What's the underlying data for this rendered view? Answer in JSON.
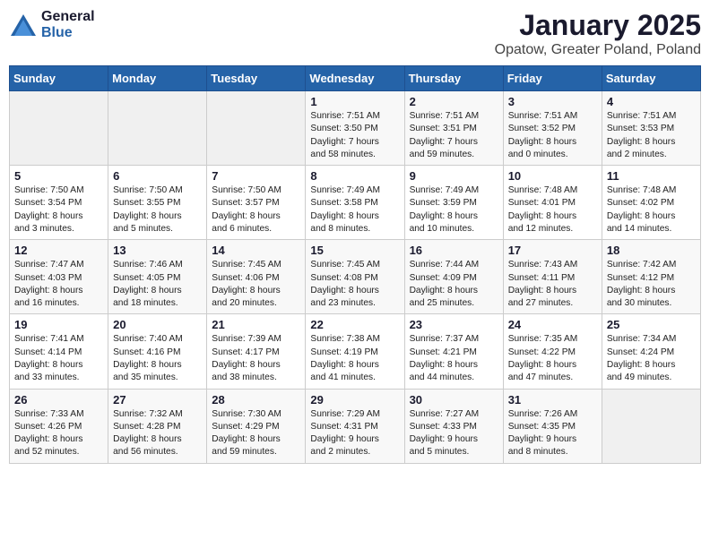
{
  "logo": {
    "general": "General",
    "blue": "Blue"
  },
  "title": "January 2025",
  "subtitle": "Opatow, Greater Poland, Poland",
  "weekdays": [
    "Sunday",
    "Monday",
    "Tuesday",
    "Wednesday",
    "Thursday",
    "Friday",
    "Saturday"
  ],
  "weeks": [
    [
      {
        "day": "",
        "content": ""
      },
      {
        "day": "",
        "content": ""
      },
      {
        "day": "",
        "content": ""
      },
      {
        "day": "1",
        "content": "Sunrise: 7:51 AM\nSunset: 3:50 PM\nDaylight: 7 hours\nand 58 minutes."
      },
      {
        "day": "2",
        "content": "Sunrise: 7:51 AM\nSunset: 3:51 PM\nDaylight: 7 hours\nand 59 minutes."
      },
      {
        "day": "3",
        "content": "Sunrise: 7:51 AM\nSunset: 3:52 PM\nDaylight: 8 hours\nand 0 minutes."
      },
      {
        "day": "4",
        "content": "Sunrise: 7:51 AM\nSunset: 3:53 PM\nDaylight: 8 hours\nand 2 minutes."
      }
    ],
    [
      {
        "day": "5",
        "content": "Sunrise: 7:50 AM\nSunset: 3:54 PM\nDaylight: 8 hours\nand 3 minutes."
      },
      {
        "day": "6",
        "content": "Sunrise: 7:50 AM\nSunset: 3:55 PM\nDaylight: 8 hours\nand 5 minutes."
      },
      {
        "day": "7",
        "content": "Sunrise: 7:50 AM\nSunset: 3:57 PM\nDaylight: 8 hours\nand 6 minutes."
      },
      {
        "day": "8",
        "content": "Sunrise: 7:49 AM\nSunset: 3:58 PM\nDaylight: 8 hours\nand 8 minutes."
      },
      {
        "day": "9",
        "content": "Sunrise: 7:49 AM\nSunset: 3:59 PM\nDaylight: 8 hours\nand 10 minutes."
      },
      {
        "day": "10",
        "content": "Sunrise: 7:48 AM\nSunset: 4:01 PM\nDaylight: 8 hours\nand 12 minutes."
      },
      {
        "day": "11",
        "content": "Sunrise: 7:48 AM\nSunset: 4:02 PM\nDaylight: 8 hours\nand 14 minutes."
      }
    ],
    [
      {
        "day": "12",
        "content": "Sunrise: 7:47 AM\nSunset: 4:03 PM\nDaylight: 8 hours\nand 16 minutes."
      },
      {
        "day": "13",
        "content": "Sunrise: 7:46 AM\nSunset: 4:05 PM\nDaylight: 8 hours\nand 18 minutes."
      },
      {
        "day": "14",
        "content": "Sunrise: 7:45 AM\nSunset: 4:06 PM\nDaylight: 8 hours\nand 20 minutes."
      },
      {
        "day": "15",
        "content": "Sunrise: 7:45 AM\nSunset: 4:08 PM\nDaylight: 8 hours\nand 23 minutes."
      },
      {
        "day": "16",
        "content": "Sunrise: 7:44 AM\nSunset: 4:09 PM\nDaylight: 8 hours\nand 25 minutes."
      },
      {
        "day": "17",
        "content": "Sunrise: 7:43 AM\nSunset: 4:11 PM\nDaylight: 8 hours\nand 27 minutes."
      },
      {
        "day": "18",
        "content": "Sunrise: 7:42 AM\nSunset: 4:12 PM\nDaylight: 8 hours\nand 30 minutes."
      }
    ],
    [
      {
        "day": "19",
        "content": "Sunrise: 7:41 AM\nSunset: 4:14 PM\nDaylight: 8 hours\nand 33 minutes."
      },
      {
        "day": "20",
        "content": "Sunrise: 7:40 AM\nSunset: 4:16 PM\nDaylight: 8 hours\nand 35 minutes."
      },
      {
        "day": "21",
        "content": "Sunrise: 7:39 AM\nSunset: 4:17 PM\nDaylight: 8 hours\nand 38 minutes."
      },
      {
        "day": "22",
        "content": "Sunrise: 7:38 AM\nSunset: 4:19 PM\nDaylight: 8 hours\nand 41 minutes."
      },
      {
        "day": "23",
        "content": "Sunrise: 7:37 AM\nSunset: 4:21 PM\nDaylight: 8 hours\nand 44 minutes."
      },
      {
        "day": "24",
        "content": "Sunrise: 7:35 AM\nSunset: 4:22 PM\nDaylight: 8 hours\nand 47 minutes."
      },
      {
        "day": "25",
        "content": "Sunrise: 7:34 AM\nSunset: 4:24 PM\nDaylight: 8 hours\nand 49 minutes."
      }
    ],
    [
      {
        "day": "26",
        "content": "Sunrise: 7:33 AM\nSunset: 4:26 PM\nDaylight: 8 hours\nand 52 minutes."
      },
      {
        "day": "27",
        "content": "Sunrise: 7:32 AM\nSunset: 4:28 PM\nDaylight: 8 hours\nand 56 minutes."
      },
      {
        "day": "28",
        "content": "Sunrise: 7:30 AM\nSunset: 4:29 PM\nDaylight: 8 hours\nand 59 minutes."
      },
      {
        "day": "29",
        "content": "Sunrise: 7:29 AM\nSunset: 4:31 PM\nDaylight: 9 hours\nand 2 minutes."
      },
      {
        "day": "30",
        "content": "Sunrise: 7:27 AM\nSunset: 4:33 PM\nDaylight: 9 hours\nand 5 minutes."
      },
      {
        "day": "31",
        "content": "Sunrise: 7:26 AM\nSunset: 4:35 PM\nDaylight: 9 hours\nand 8 minutes."
      },
      {
        "day": "",
        "content": ""
      }
    ]
  ]
}
